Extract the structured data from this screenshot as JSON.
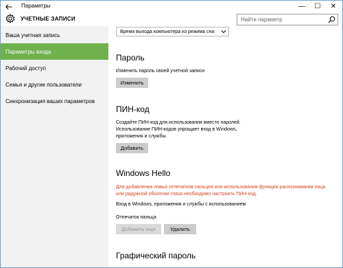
{
  "window": {
    "title": "Параметры",
    "back_icon": "back-arrow-icon",
    "controls": {
      "minimize": "—",
      "maximize": "☐",
      "close": "✕"
    }
  },
  "header": {
    "title": "УЧЕТНЫЕ ЗАПИСИ",
    "icon": "gear-icon",
    "search_placeholder": "Найти параметр",
    "search_value": ""
  },
  "sidebar": {
    "items": [
      {
        "label": "Ваша учетная запись",
        "active": false
      },
      {
        "label": "Параметры входа",
        "active": true
      },
      {
        "label": "Рабочий доступ",
        "active": false
      },
      {
        "label": "Семья и другие пользователи",
        "active": false
      },
      {
        "label": "Синхронизация ваших параметров",
        "active": false
      }
    ],
    "accent_color": "#6eb14d"
  },
  "main": {
    "signin_dropdown": {
      "selected": "Время выхода компьютера из режима сна"
    },
    "password": {
      "heading": "Пароль",
      "description": "Изменить пароль своей учетной записи",
      "button": "Изменить"
    },
    "pin": {
      "heading": "ПИН-код",
      "description_lines": [
        "Создайте ПИН-код для использования вместо паролей.",
        "Использование ПИН-кодов упрощает вход в Windows,",
        "приложения и службы."
      ],
      "button": "Добавить"
    },
    "windows_hello": {
      "heading": "Windows Hello",
      "warning_lines": [
        "Для добавления новых отпечатков пальцев или использования функции распознавании лица",
        "или радужной оболочки глаза необходимо настроить ПИН-код."
      ],
      "warning_color": "#d3451c",
      "description": "Вход в Windows, приложения и службы с использованием",
      "fingerprint_label": "Отпечаток пальца",
      "add_more_button": "Добавить еще",
      "remove_button": "Удалить"
    },
    "picture_password": {
      "heading": "Графический пароль"
    }
  }
}
